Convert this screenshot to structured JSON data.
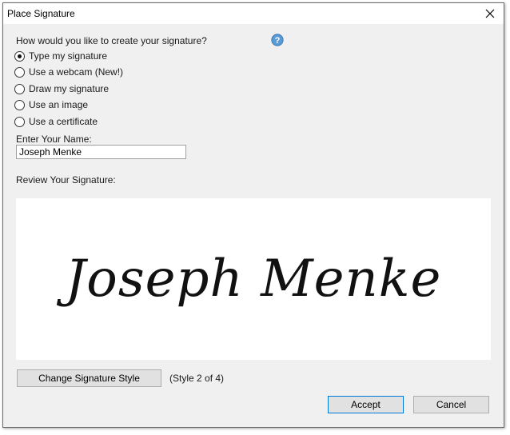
{
  "window": {
    "title": "Place Signature"
  },
  "prompt": "How would you like to create your signature?",
  "options": [
    {
      "label": "Type my signature",
      "checked": true
    },
    {
      "label": "Use a webcam (New!)",
      "checked": false
    },
    {
      "label": "Draw my signature",
      "checked": false
    },
    {
      "label": "Use an image",
      "checked": false
    },
    {
      "label": "Use a certificate",
      "checked": false
    }
  ],
  "name_field": {
    "label": "Enter Your Name:",
    "value": "Joseph Menke"
  },
  "review": {
    "label": "Review Your Signature:",
    "signature_text": "Joseph Menke"
  },
  "style": {
    "button_label": "Change Signature Style",
    "count_text": "(Style 2 of 4)"
  },
  "buttons": {
    "accept": "Accept",
    "cancel": "Cancel"
  },
  "colors": {
    "help_icon": "#5b9bd5",
    "accent_border": "#0078d7"
  }
}
